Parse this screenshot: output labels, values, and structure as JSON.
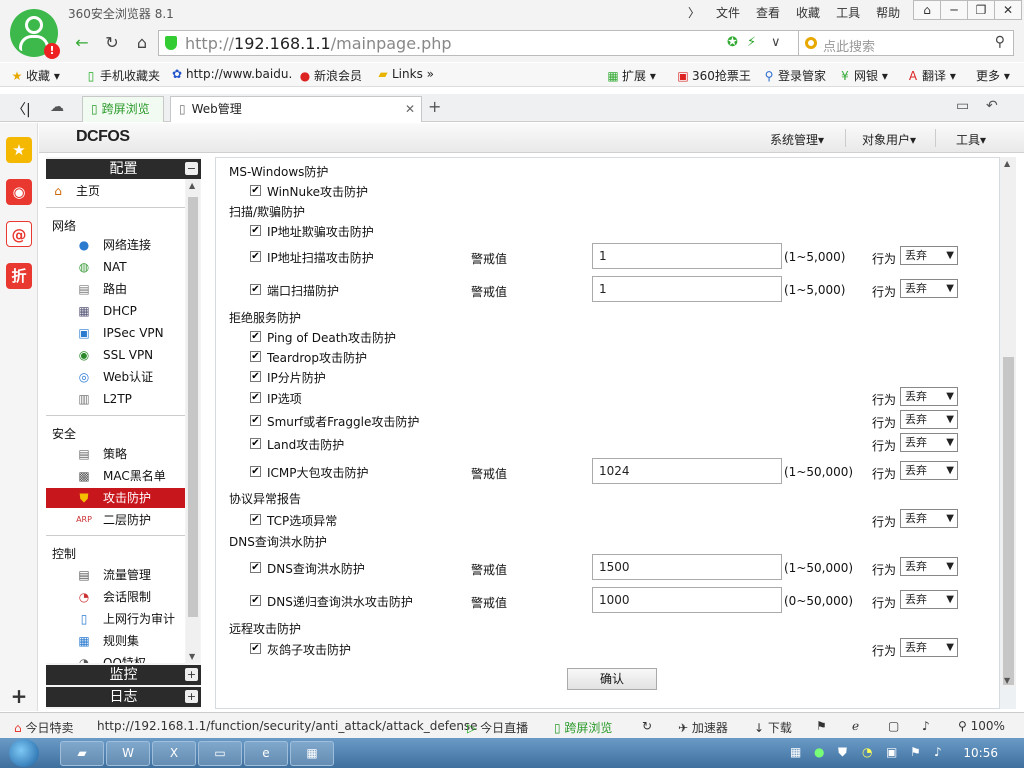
{
  "browser": {
    "title": "360安全浏览器 8.1",
    "menu": [
      "文件",
      "查看",
      "收藏",
      "工具",
      "帮助"
    ],
    "url_host": "192.168.1.1",
    "url_prefix": "http://",
    "url_path": "/mainpage.php",
    "search_placeholder": "点此搜索"
  },
  "bookmarks": {
    "left": [
      "收藏",
      "手机收藏夹",
      "http://www.baidu.",
      "新浪会员",
      "Links"
    ],
    "right": [
      "扩展",
      "360抢票王",
      "登录管家",
      "网银",
      "翻译",
      "更多"
    ]
  },
  "tabs": [
    {
      "label": "跨屏浏览"
    },
    {
      "label": "Web管理"
    }
  ],
  "app": {
    "brand": "DCFOS",
    "header_menu": [
      "系统管理",
      "对象用户",
      "工具"
    ]
  },
  "nav": {
    "config_label": "配置",
    "monitor_label": "监控",
    "log_label": "日志",
    "home": "主页",
    "group_network": "网络",
    "network_items": [
      "网络连接",
      "NAT",
      "路由",
      "DHCP",
      "IPSec VPN",
      "SSL VPN",
      "Web认证",
      "L2TP"
    ],
    "group_security": "安全",
    "security_items": [
      "策略",
      "MAC黑名单",
      "攻击防护",
      "二层防护"
    ],
    "group_control": "控制",
    "control_items": [
      "流量管理",
      "会话限制",
      "上网行为审计",
      "规则集",
      "QQ特权"
    ]
  },
  "content": {
    "sections": {
      "ms_windows": "MS-Windows防护",
      "scan": "扫描/欺骗防护",
      "dos": "拒绝服务防护",
      "proto": "协议异常报告",
      "dns": "DNS查询洪水防护",
      "remote": "远程攻击防护"
    },
    "warn_label": "警戒值",
    "action_label": "行为",
    "action_value": "丢弃",
    "rows": {
      "winnuke": "WinNuke攻击防护",
      "ip_spoof": "IP地址欺骗攻击防护",
      "ip_scan": "IP地址扫描攻击防护",
      "ip_scan_value": "1",
      "ip_scan_range": "(1~5,000)",
      "port_scan": "端口扫描防护",
      "port_scan_value": "1",
      "port_scan_range": "(1~5,000)",
      "ping_death": "Ping of Death攻击防护",
      "teardrop": "Teardrop攻击防护",
      "ip_frag": "IP分片防护",
      "ip_opt": "IP选项",
      "smurf": "Smurf或者Fraggle攻击防护",
      "land": "Land攻击防护",
      "icmp": "ICMP大包攻击防护",
      "icmp_value": "1024",
      "icmp_range": "(1~50,000)",
      "tcp_opt": "TCP选项异常",
      "dns_flood": "DNS查询洪水防护",
      "dns_flood_value": "1500",
      "dns_flood_range": "(1~50,000)",
      "dns_rec": "DNS递归查询洪水攻击防护",
      "dns_rec_value": "1000",
      "dns_rec_range": "(0~50,000)",
      "gray": "灰鸽子攻击防护"
    },
    "confirm": "确认"
  },
  "status": {
    "left": "今日特卖",
    "url": "http://192.168.1.1/function/security/anti_attack/attack_defense",
    "live": "今日直播",
    "cross": "跨屏浏览",
    "accel": "加速器",
    "download": "下载",
    "zoom": "100%"
  },
  "taskbar": {
    "time": "10:56"
  }
}
